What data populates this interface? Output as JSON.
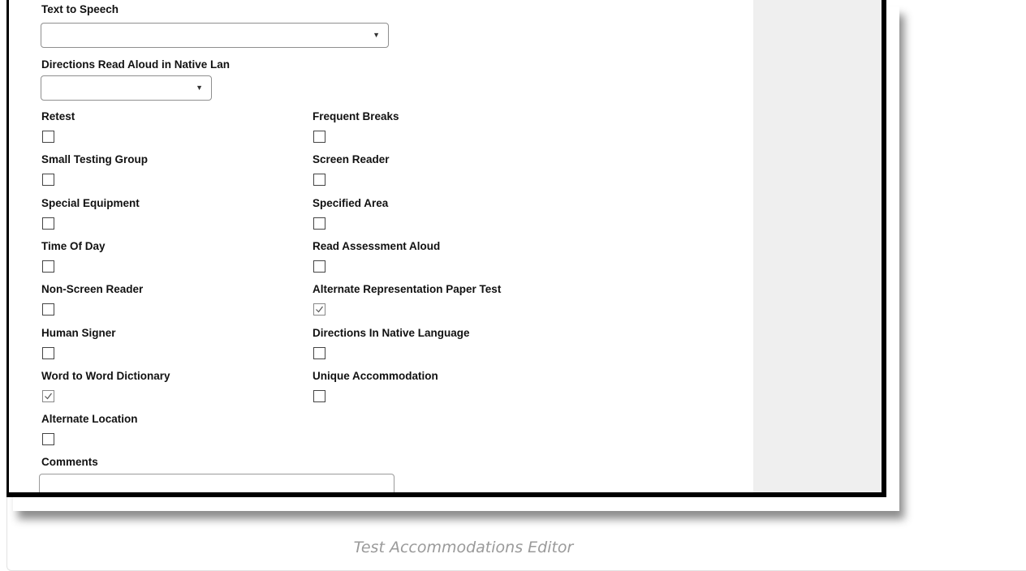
{
  "form": {
    "text_to_speech_label": "Text to Speech",
    "text_to_speech_value": "",
    "directions_native_label": "Directions Read Aloud in Native Lan",
    "directions_native_value": "",
    "dropdown_arrow": "▼",
    "checkboxes": [
      {
        "label": "Retest",
        "checked": false
      },
      {
        "label": "Frequent Breaks",
        "checked": false
      },
      {
        "label": "Small Testing Group",
        "checked": false
      },
      {
        "label": "Screen Reader",
        "checked": false
      },
      {
        "label": "Special Equipment",
        "checked": false
      },
      {
        "label": "Specified Area",
        "checked": false
      },
      {
        "label": "Time Of Day",
        "checked": false
      },
      {
        "label": "Read Assessment Aloud",
        "checked": false
      },
      {
        "label": "Non-Screen Reader",
        "checked": false
      },
      {
        "label": "Alternate Representation Paper Test",
        "checked": true
      },
      {
        "label": "Human Signer",
        "checked": false
      },
      {
        "label": "Directions In Native Language",
        "checked": false
      },
      {
        "label": "Word to Word Dictionary",
        "checked": true
      },
      {
        "label": "Unique Accommodation",
        "checked": false
      },
      {
        "label": "Alternate Location",
        "checked": false
      }
    ],
    "comments_label": "Comments",
    "comments_value": ""
  },
  "caption": "Test Accommodations Editor",
  "colors": {
    "side_panel": "#efefef",
    "caption": "#9a9a9a",
    "frame_border": "#000000"
  }
}
